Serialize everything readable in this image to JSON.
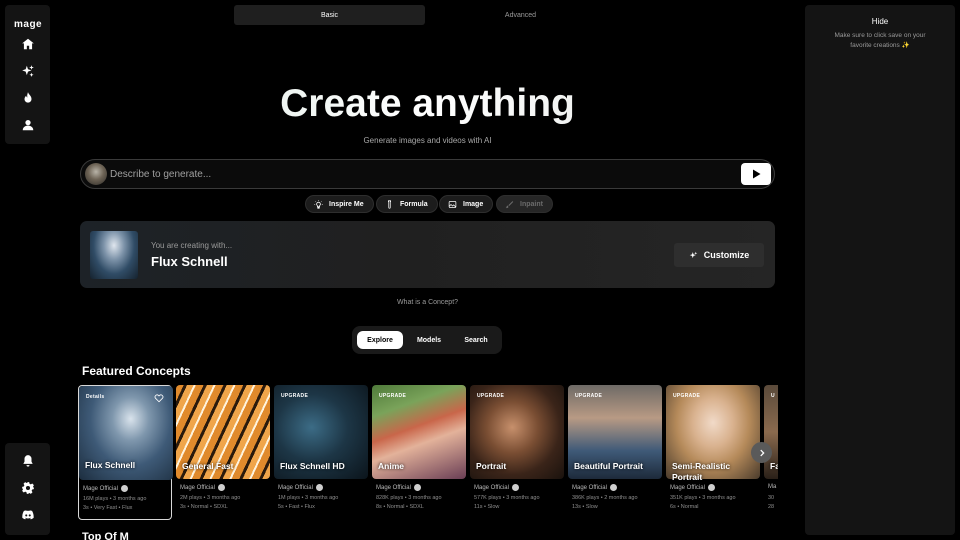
{
  "app": {
    "logo": "mage"
  },
  "sidebar": {
    "top_items": [
      {
        "icon": "home-icon"
      },
      {
        "icon": "sparkles-icon"
      },
      {
        "icon": "flame-icon"
      },
      {
        "icon": "user-icon"
      }
    ],
    "bottom_items": [
      {
        "icon": "bell-icon"
      },
      {
        "icon": "gear-icon"
      },
      {
        "icon": "discord-icon"
      }
    ]
  },
  "mode_tabs": {
    "basic": "Basic",
    "advanced": "Advanced"
  },
  "hero": {
    "title": "Create anything",
    "subtitle": "Generate images and videos with AI"
  },
  "prompt": {
    "placeholder": "Describe to generate...",
    "value": ""
  },
  "chips": {
    "inspire": "Inspire Me",
    "formula": "Formula",
    "image": "Image",
    "inpaint": "Inpaint"
  },
  "concept": {
    "label": "You are creating with...",
    "name": "Flux Schnell",
    "customize": "Customize"
  },
  "whatis": "What is a Concept?",
  "explore_tabs": {
    "explore": "Explore",
    "models": "Models",
    "search": "Search"
  },
  "featured_title": "Featured Concepts",
  "cards": [
    {
      "badge": "Details",
      "title": "Flux Schnell",
      "by": "Mage Official",
      "meta1": "16M plays • 3 months ago",
      "meta2": "3s • Very Fast • Flux"
    },
    {
      "badge": "",
      "title": "General Fast",
      "by": "Mage Official",
      "meta1": "2M plays • 3 months ago",
      "meta2": "3s • Normal • SDXL"
    },
    {
      "badge": "UPGRADE",
      "title": "Flux Schnell HD",
      "by": "Mage Official",
      "meta1": "1M plays • 3 months ago",
      "meta2": "5s • Fast • Flux"
    },
    {
      "badge": "UPGRADE",
      "title": "Anime",
      "by": "Mage Official",
      "meta1": "828K plays • 3 months ago",
      "meta2": "8s • Normal • SDXL"
    },
    {
      "badge": "UPGRADE",
      "title": "Portrait",
      "by": "Mage Official",
      "meta1": "577K plays • 3 months ago",
      "meta2": "11s • Slow"
    },
    {
      "badge": "UPGRADE",
      "title": "Beautiful Portrait",
      "by": "Mage Official",
      "meta1": "386K plays • 2 months ago",
      "meta2": "13s • Slow"
    },
    {
      "badge": "UPGRADE",
      "title": "Semi-Realistic Portrait",
      "by": "Mage Official",
      "meta1": "351K plays • 3 months ago",
      "meta2": "6s • Normal"
    },
    {
      "badge": "U",
      "title": "Fa",
      "by": "Ma",
      "meta1": "30",
      "meta2": "28"
    }
  ],
  "right_panel": {
    "hide": "Hide",
    "note": "Make sure to click save on your favorite creations ✨"
  },
  "bottom_peek": "Top Of M"
}
